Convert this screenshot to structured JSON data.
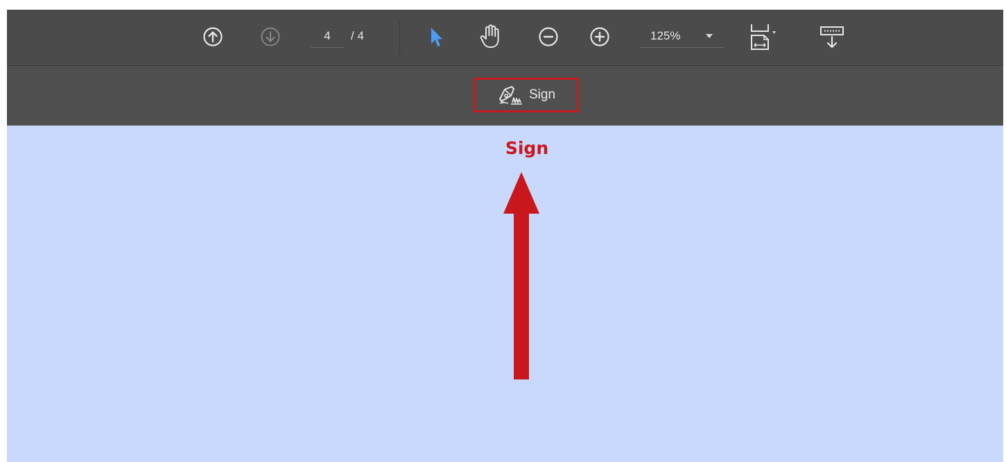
{
  "toolbar": {
    "page_current": "4",
    "page_total": "/ 4",
    "zoom": "125%",
    "icons": {
      "prev_page": "arrow-up-circle-icon",
      "next_page": "arrow-down-circle-icon",
      "select_tool": "cursor-arrow-icon",
      "hand_tool": "hand-icon",
      "zoom_out": "minus-circle-icon",
      "zoom_in": "plus-circle-icon",
      "page_fit": "page-fit-icon",
      "download": "download-tray-icon"
    },
    "colors": {
      "background": "#4b4b4b",
      "icon": "#e6e6e6",
      "icon_disabled": "#8a8a8a",
      "select_active": "#4a9df7"
    }
  },
  "sign_bar": {
    "sign_label": "Sign",
    "sign_icon": "pen-signature-icon",
    "highlight_color": "#c71b1b"
  },
  "annotation": {
    "label": "Sign",
    "color": "#c9181d"
  },
  "canvas": {
    "background": "#c9d9fb"
  }
}
